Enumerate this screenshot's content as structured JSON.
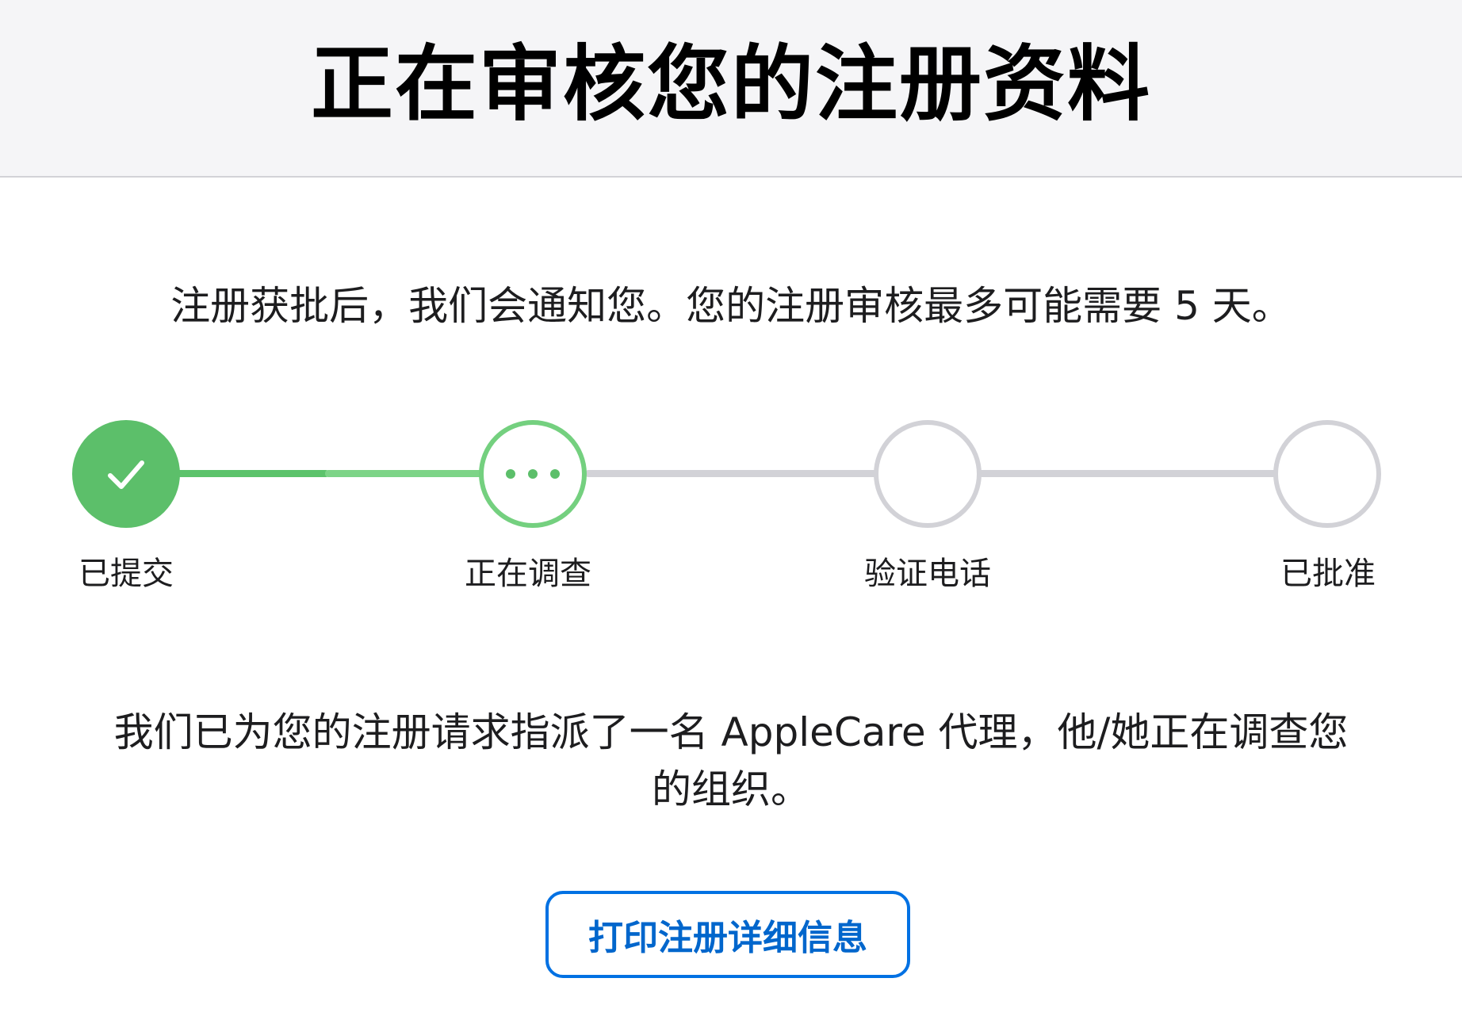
{
  "header": {
    "title": "正在审核您的注册资料"
  },
  "intro": {
    "text": "注册获批后，我们会通知您。您的注册审核最多可能需要 5 天。"
  },
  "stepper": {
    "steps": [
      {
        "label": "已提交",
        "state": "completed",
        "icon": "checkmark-icon"
      },
      {
        "label": "正在调查",
        "state": "active",
        "icon": "ellipsis-icon"
      },
      {
        "label": "验证电话",
        "state": "pending",
        "icon": "empty-circle-icon"
      },
      {
        "label": "已批准",
        "state": "pending",
        "icon": "empty-circle-icon"
      }
    ],
    "colors": {
      "completed": "#5cbf6a",
      "active": "#74d07f",
      "pending": "#d2d2d7"
    }
  },
  "body": {
    "text": "我们已为您的注册请求指派了一名 AppleCare 代理，他/她正在调查您的组织。"
  },
  "actions": {
    "print_label": "打印注册详细信息",
    "accent_color": "#0071e3"
  }
}
